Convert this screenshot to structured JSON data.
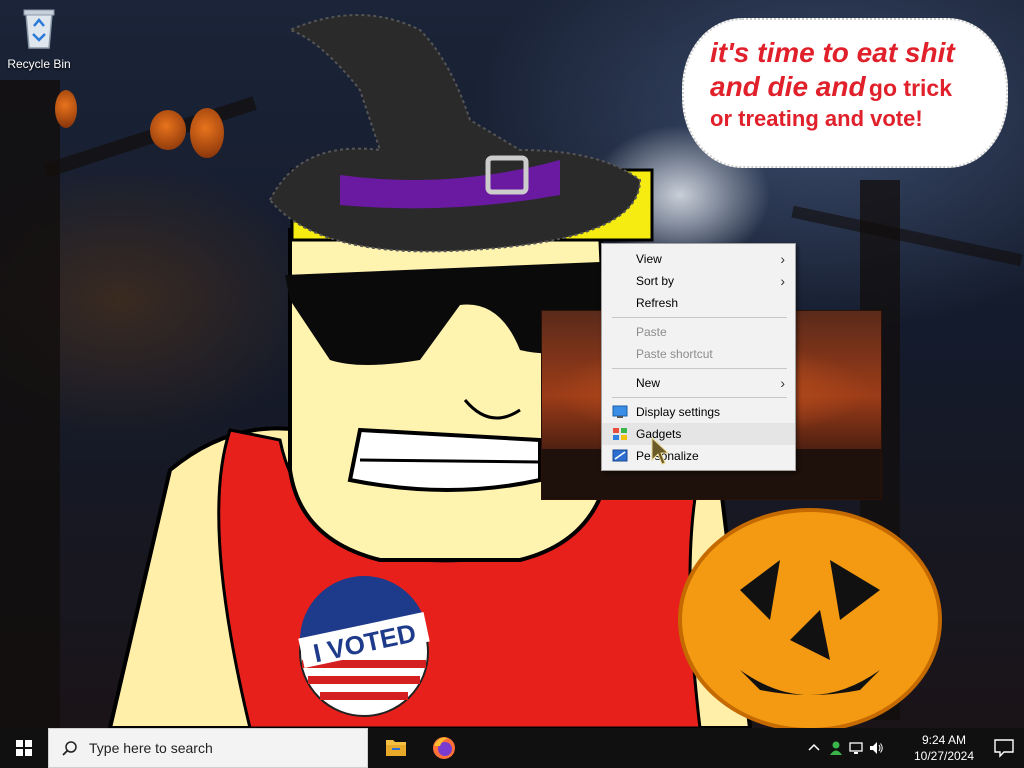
{
  "desktop": {
    "icons": [
      {
        "label": "Recycle Bin",
        "icon": "recycle-bin-icon"
      }
    ],
    "wallpaper": {
      "speech_bubble": {
        "line1": "it's time to eat shit",
        "line2a": "and die and",
        "line2b": "go trick",
        "line3": "or treating and vote!"
      },
      "sticker_text": "I VOTED"
    }
  },
  "context_menu": {
    "items": [
      {
        "label": "View",
        "submenu": true,
        "enabled": true
      },
      {
        "label": "Sort by",
        "submenu": true,
        "enabled": true
      },
      {
        "label": "Refresh",
        "submenu": false,
        "enabled": true
      },
      {
        "label": "Paste",
        "submenu": false,
        "enabled": false
      },
      {
        "label": "Paste shortcut",
        "submenu": false,
        "enabled": false
      },
      {
        "label": "New",
        "submenu": true,
        "enabled": true
      },
      {
        "label": "Display settings",
        "submenu": false,
        "enabled": true,
        "icon": "display-icon"
      },
      {
        "label": "Gadgets",
        "submenu": false,
        "enabled": true,
        "icon": "gadgets-icon",
        "hovered": true
      },
      {
        "label": "Personalize",
        "submenu": false,
        "enabled": true,
        "icon": "personalize-icon"
      }
    ],
    "submenu_arrow": "›"
  },
  "taskbar": {
    "search_placeholder": "Type here to search",
    "pinned_apps": [
      {
        "name": "File Explorer",
        "icon": "folder-icon"
      },
      {
        "name": "Firefox",
        "icon": "firefox-icon"
      }
    ],
    "tray": {
      "time": "9:24 AM",
      "date": "10/27/2024"
    }
  },
  "colors": {
    "taskbar_bg": "#101010",
    "menu_bg": "#f2f2f2",
    "speech_text": "#e0202a",
    "accent": "#0078d7"
  }
}
